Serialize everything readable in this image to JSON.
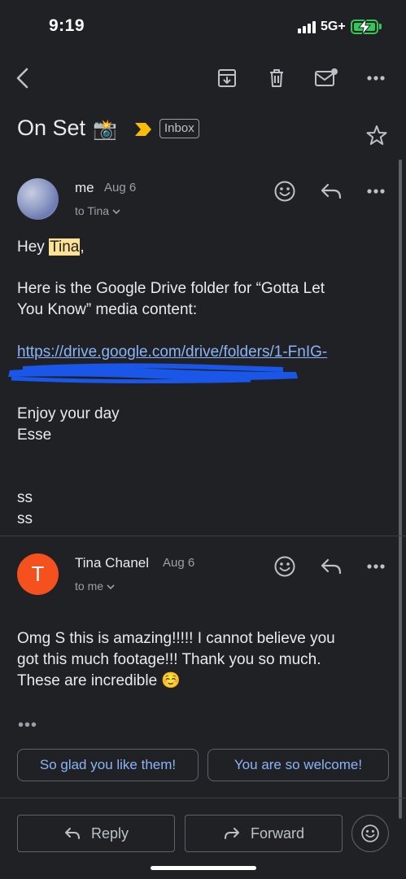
{
  "status_bar": {
    "time": "9:19",
    "network": "5G+"
  },
  "email": {
    "subject": "On Set",
    "subject_emoji": "📸",
    "label": "Inbox"
  },
  "messages": [
    {
      "sender": "me",
      "date": "Aug 6",
      "recipient": "to Tina",
      "greeting_prefix": "Hey ",
      "greeting_name": "Tina",
      "greeting_suffix": ",",
      "line1": "Here is the Google Drive folder for “Gotta Let",
      "line2": "You Know” media content:",
      "link": "https://drive.google.com/drive/folders/1-FnIG-",
      "sign_off_1": "Enjoy your day",
      "sign_off_2": "Esse",
      "signature_1": "ss",
      "signature_2": "ss"
    },
    {
      "sender": "Tina Chanel",
      "avatar_letter": "T",
      "date": "Aug 6",
      "recipient": "to me",
      "line1": "Omg S this is amazing!!!!! I cannot believe you",
      "line2": "got this much footage!!! Thank you so much.",
      "line3": "These are incredible ☺️"
    }
  ],
  "quoted_ellipsis": "•••",
  "smart_replies": [
    "So glad you like them!",
    "You are so welcome!"
  ],
  "actions": {
    "reply": "Reply",
    "forward": "Forward"
  },
  "colors": {
    "background": "#202124",
    "link": "#8ab4f8",
    "avatar_t": "#f4511e",
    "highlight": "#fde293",
    "important": "#fbbc04",
    "battery": "#34c759"
  }
}
